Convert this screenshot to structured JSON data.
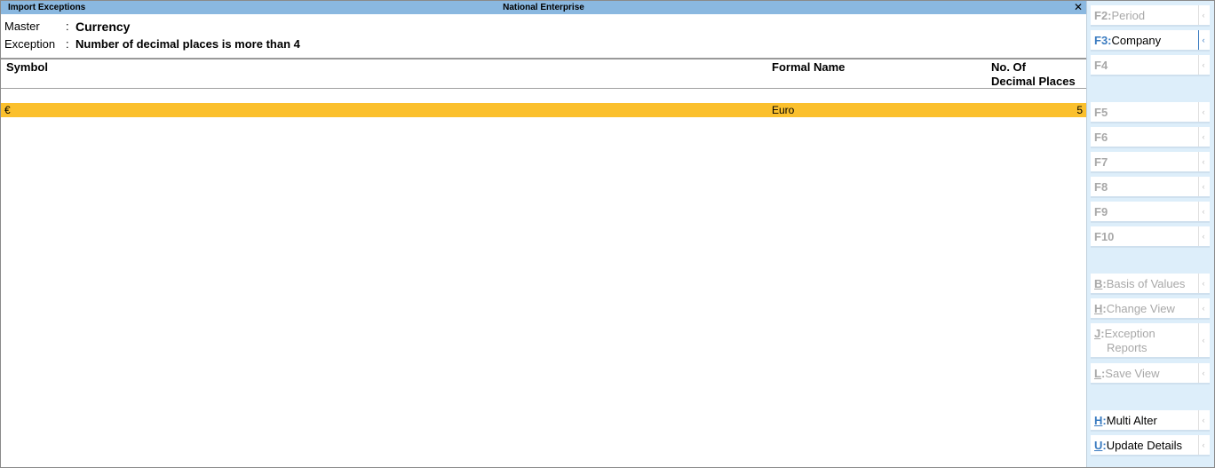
{
  "titlebar": {
    "title": "Import Exceptions",
    "company": "National Enterprise",
    "close_glyph": "✕"
  },
  "info": {
    "master_label": "Master",
    "master_value": "Currency",
    "exception_label": "Exception",
    "exception_value": "Number of decimal places is more than 4",
    "colon": ":"
  },
  "table": {
    "headers": {
      "symbol": "Symbol",
      "formal_name": "Formal Name",
      "decimal_line1": "No. Of",
      "decimal_line2": "Decimal Places"
    },
    "rows": [
      {
        "symbol": "€",
        "formal_name": "Euro",
        "decimal_places": "5"
      }
    ]
  },
  "sidebar": {
    "chev": "‹",
    "buttons": [
      {
        "key": "F2:",
        "label": "Period"
      },
      {
        "key": "F3:",
        "label": "Company"
      },
      {
        "key": "F4",
        "label": ""
      },
      {
        "key": "F5",
        "label": ""
      },
      {
        "key": "F6",
        "label": ""
      },
      {
        "key": "F7",
        "label": ""
      },
      {
        "key": "F8",
        "label": ""
      },
      {
        "key": "F9",
        "label": ""
      },
      {
        "key": "F10",
        "label": ""
      },
      {
        "key": "B",
        "label": "Basis of Values"
      },
      {
        "key": "H",
        "label": "Change View"
      },
      {
        "key": "J",
        "label": "Exception",
        "label2": "Reports"
      },
      {
        "key": "L",
        "label": "Save View"
      },
      {
        "key": "H",
        "label": "Multi Alter"
      },
      {
        "key": "U",
        "label": "Update Details"
      }
    ]
  },
  "colors": {
    "title_bar": "#8ab8e0",
    "row_highlight": "#fbc02d",
    "sidebar_bg": "#ddeefa",
    "accent": "#3a7bc0"
  }
}
